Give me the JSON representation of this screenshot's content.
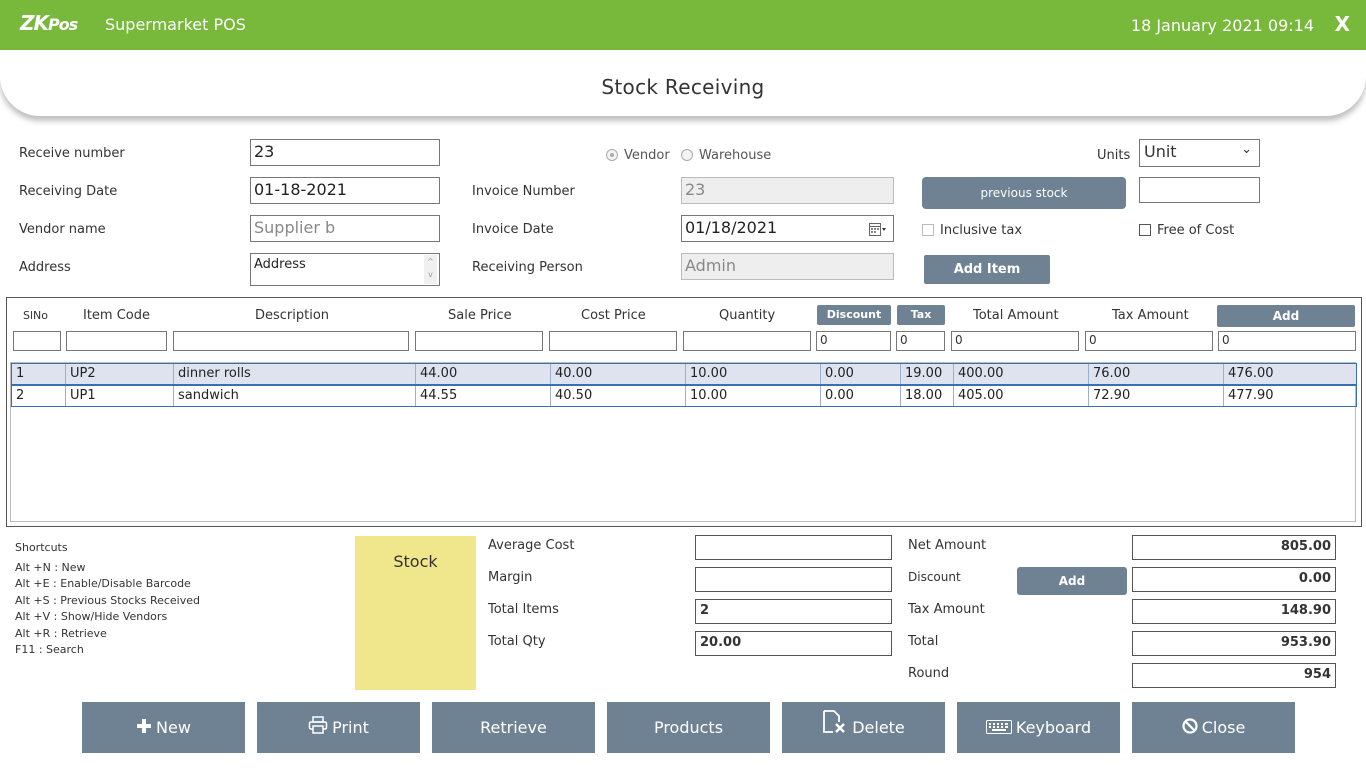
{
  "app": {
    "logo_main": "ZK",
    "logo_sub": "Pos",
    "title": "Supermarket POS",
    "datetime": "18 January 2021 09:14",
    "close": "X",
    "accent": "#78b83b"
  },
  "page": {
    "title": "Stock Receiving"
  },
  "form": {
    "receive_number_label": "Receive number",
    "receive_number": "23",
    "receiving_date_label": "Receiving Date",
    "receiving_date": "01-18-2021",
    "vendor_name_label": "Vendor name",
    "vendor_name_placeholder": "Supplier b",
    "address_label": "Address",
    "address_placeholder": "Address",
    "radio_vendor": "Vendor",
    "radio_warehouse": "Warehouse",
    "invoice_number_label": "Invoice Number",
    "invoice_number": "23",
    "invoice_date_label": "Invoice Date",
    "invoice_date": "01/18/2021",
    "receiving_person_label": "Receiving Person",
    "receiving_person": "Admin",
    "previous_stock_button": "previous stock",
    "inclusive_tax": "Inclusive tax",
    "add_item_button": "Add Item",
    "units_label": "Units",
    "units_value": "Unit",
    "units_extra": "",
    "free_of_cost": "Free of Cost"
  },
  "grid": {
    "headers": {
      "slno": "SlNo",
      "item_code": "Item Code",
      "description": "Description",
      "sale_price": "Sale Price",
      "cost_price": "Cost Price",
      "quantity": "Quantity",
      "discount": "Discount",
      "tax": "Tax",
      "total_amount": "Total Amount",
      "tax_amount": "Tax Amount",
      "add": "Add"
    },
    "filters": {
      "discount": "0",
      "tax": "0",
      "total_amount": "0",
      "tax_amount": "0",
      "add": "0"
    },
    "rows": [
      {
        "slno": "1",
        "code": "UP2",
        "desc": "dinner rolls",
        "sale": "44.00",
        "cost": "40.00",
        "qty": "10.00",
        "disc": "0.00",
        "tax": "19.00",
        "total": "400.00",
        "taxamt": "76.00",
        "net": "476.00"
      },
      {
        "slno": "2",
        "code": "UP1",
        "desc": "sandwich",
        "sale": "44.55",
        "cost": "40.50",
        "qty": "10.00",
        "disc": "0.00",
        "tax": "18.00",
        "total": "405.00",
        "taxamt": "72.90",
        "net": "477.90"
      }
    ]
  },
  "shortcuts": {
    "title": "Shortcuts",
    "items": [
      "Alt +N : New",
      "Alt +E : Enable/Disable Barcode",
      "Alt +S : Previous Stocks Received",
      "Alt +V : Show/Hide Vendors",
      "Alt +R : Retrieve",
      "F11 :  Search"
    ]
  },
  "stock_label": "Stock",
  "summary": {
    "average_cost_label": "Average Cost",
    "average_cost": "",
    "margin_label": "Margin",
    "margin": "",
    "total_items_label": "Total Items",
    "total_items": "2",
    "total_qty_label": "Total Qty",
    "total_qty": "20.00",
    "net_amount_label": "Net Amount",
    "net_amount": "805.00",
    "discount_label": "Discount",
    "discount_add": "Add",
    "discount": "0.00",
    "tax_amount_label": "Tax Amount",
    "tax_amount": "148.90",
    "total_label": "Total",
    "total": "953.90",
    "round_label": "Round",
    "round": "954"
  },
  "actions": {
    "new": "New",
    "print": "Print",
    "retrieve": "Retrieve",
    "products": "Products",
    "delete": "Delete",
    "keyboard": "Keyboard",
    "close": "Close"
  }
}
